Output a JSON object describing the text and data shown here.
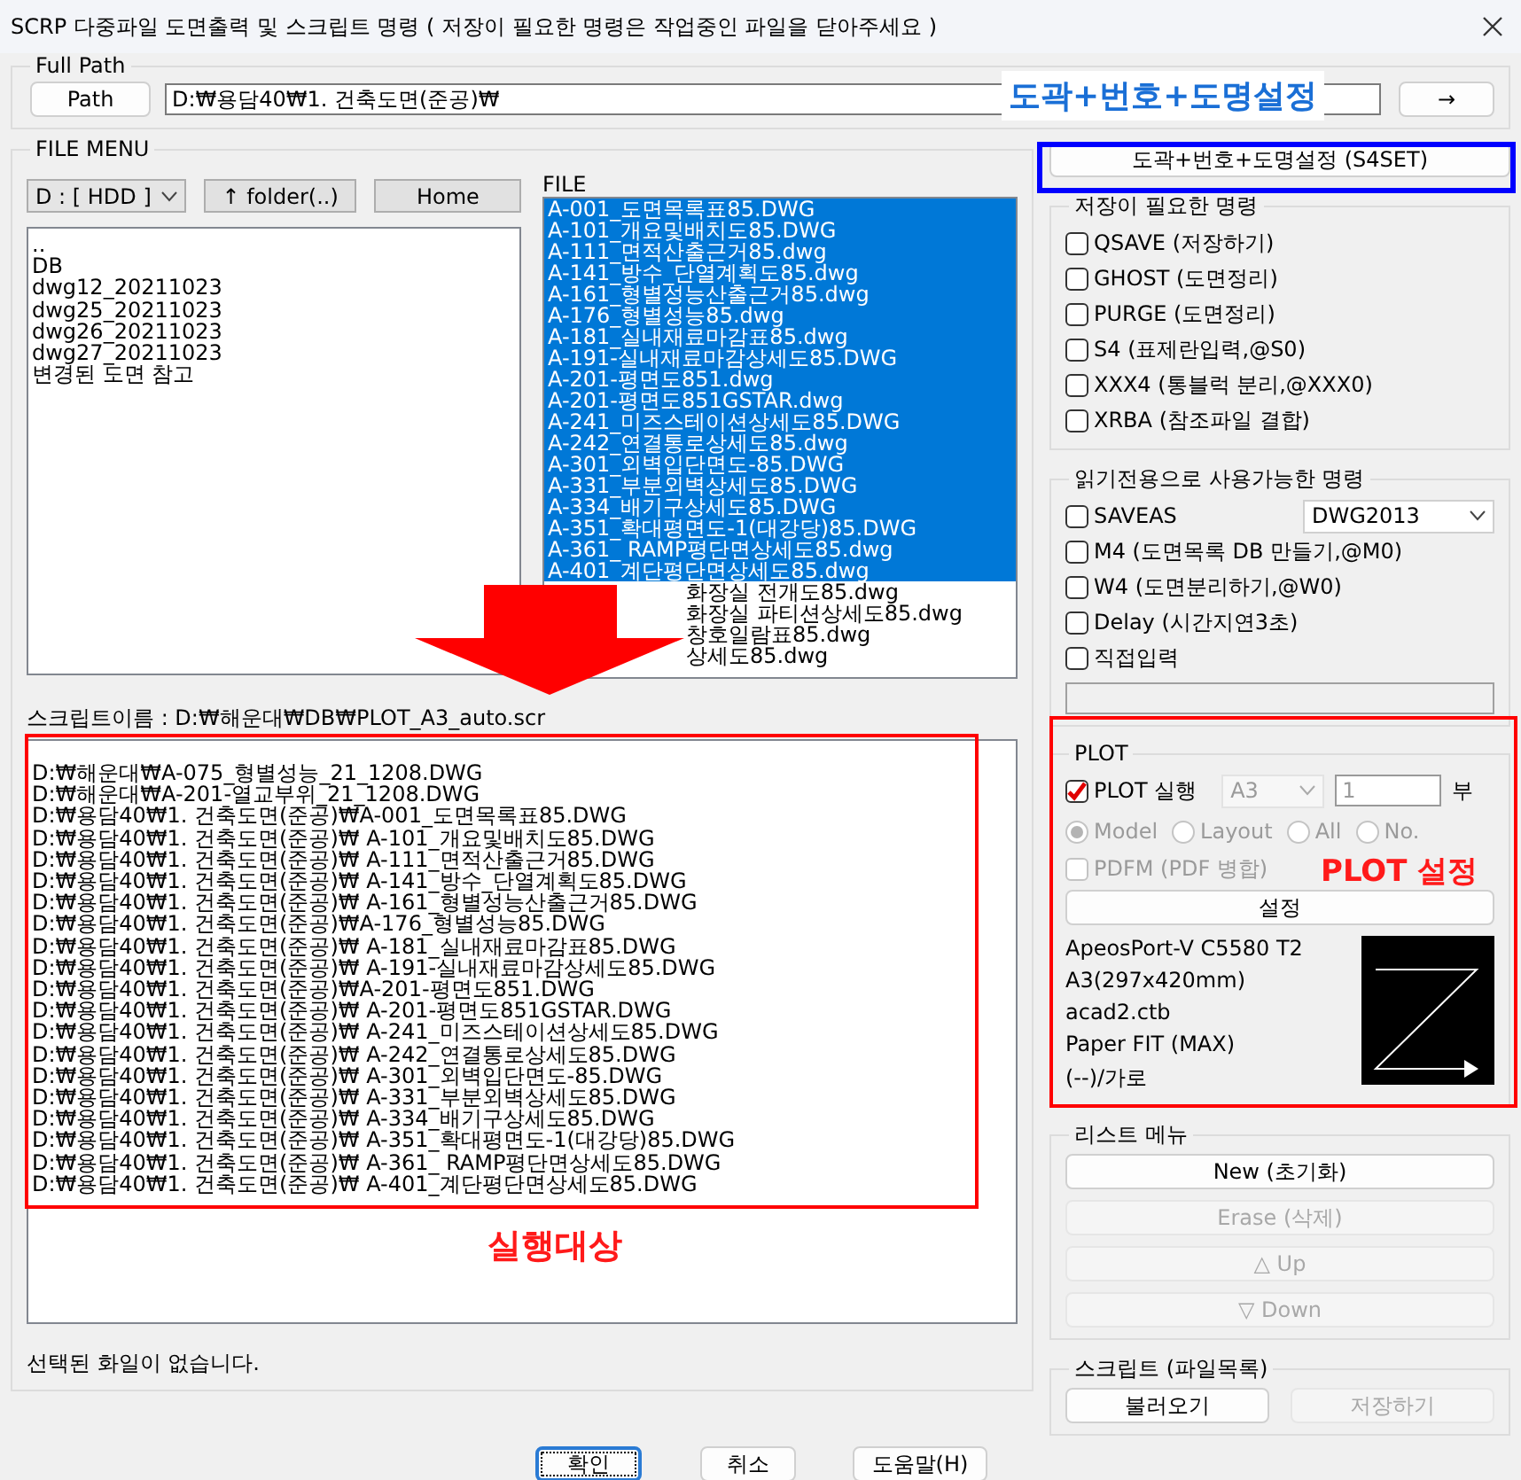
{
  "window": {
    "title": "SCRP 다중파일 도면출력 및 스크립트 명령 ( 저장이 필요한 명령은 작업중인 파일을 닫아주세요 )"
  },
  "full_path": {
    "label": "Full Path",
    "path_button": "Path",
    "path_value": "D:₩용담40₩1. 건축도면(준공)₩",
    "go_button": "→"
  },
  "file_menu": {
    "label": "FILE MENU",
    "drive": "D : [ HDD ]",
    "folder_button": "↑ folder(..)",
    "home_button": "Home",
    "folders": [
      "..",
      "DB",
      "dwg12_20211023",
      "dwg25_20211023",
      "dwg26_20211023",
      "dwg27_20211023",
      "변경된 도면 참고"
    ],
    "file_label": "FILE",
    "files": [
      {
        "name": "A-001_도면목록표85.DWG",
        "selected": true
      },
      {
        "name": "A-101_개요및배치도85.DWG",
        "selected": true
      },
      {
        "name": "A-111_면적산출근거85.dwg",
        "selected": true
      },
      {
        "name": "A-141_방수_단열계획도85.dwg",
        "selected": true
      },
      {
        "name": "A-161_형별성능산출근거85.dwg",
        "selected": true
      },
      {
        "name": "A-176_형별성능85.dwg",
        "selected": true
      },
      {
        "name": "A-181_실내재료마감표85.dwg",
        "selected": true
      },
      {
        "name": "A-191-실내재료마감상세도85.DWG",
        "selected": true
      },
      {
        "name": "A-201-평면도851.dwg",
        "selected": true
      },
      {
        "name": "A-201-평면도851GSTAR.dwg",
        "selected": true
      },
      {
        "name": "A-241_미즈스테이션상세도85.DWG",
        "selected": true
      },
      {
        "name": "A-242_연결통로상세도85.dwg",
        "selected": true
      },
      {
        "name": "A-301_외벽입단면도-85.DWG",
        "selected": true
      },
      {
        "name": "A-331_부분외벽상세도85.DWG",
        "selected": true
      },
      {
        "name": "A-334_배기구상세도85.DWG",
        "selected": true
      },
      {
        "name": "A-351_확대평면도-1(대강당)85.DWG",
        "selected": true
      },
      {
        "name": "A-361_ RAMP평단면상세도85.dwg",
        "selected": true
      },
      {
        "name": "A-401_계단평단면상세도85.dwg",
        "selected": true
      },
      {
        "name": "화장실 전개도85.dwg",
        "selected": false
      },
      {
        "name": "화장실 파티션상세도85.dwg",
        "selected": false
      },
      {
        "name": "창호일람표85.dwg",
        "selected": false
      },
      {
        "name": "상세도85.dwg",
        "selected": false
      }
    ],
    "script_name": "스크립트이름 : D:₩해운대₩DB₩PLOT_A3_auto.scr",
    "script_lines": [
      "D:₩해운대₩A-075_형별성능_21_1208.DWG",
      "D:₩해운대₩A-201-열교부위_21_1208.DWG",
      "D:₩용담40₩1. 건축도면(준공)₩A-001_도면목록표85.DWG",
      "D:₩용담40₩1. 건축도면(준공)₩ A-101_개요및배치도85.DWG",
      "D:₩용담40₩1. 건축도면(준공)₩ A-111_면적산출근거85.DWG",
      "D:₩용담40₩1. 건축도면(준공)₩ A-141_방수_단열계획도85.DWG",
      "D:₩용담40₩1. 건축도면(준공)₩ A-161_형별성능산출근거85.DWG",
      "D:₩용담40₩1. 건축도면(준공)₩A-176_형별성능85.DWG",
      "D:₩용담40₩1. 건축도면(준공)₩ A-181_실내재료마감표85.DWG",
      "D:₩용담40₩1. 건축도면(준공)₩ A-191-실내재료마감상세도85.DWG",
      "D:₩용담40₩1. 건축도면(준공)₩A-201-평면도851.DWG",
      "D:₩용담40₩1. 건축도면(준공)₩ A-201-평면도851GSTAR.DWG",
      "D:₩용담40₩1. 건축도면(준공)₩ A-241_미즈스테이션상세도85.DWG",
      "D:₩용담40₩1. 건축도면(준공)₩ A-242_연결통로상세도85.DWG",
      "D:₩용담40₩1. 건축도면(준공)₩ A-301_외벽입단면도-85.DWG",
      "D:₩용담40₩1. 건축도면(준공)₩ A-331_부분외벽상세도85.DWG",
      "D:₩용담40₩1. 건축도면(준공)₩ A-334_배기구상세도85.DWG",
      "D:₩용담40₩1. 건축도면(준공)₩ A-351_확대평면도-1(대강당)85.DWG",
      "D:₩용담40₩1. 건축도면(준공)₩ A-361_ RAMP평단면상세도85.DWG",
      "D:₩용담40₩1. 건축도면(준공)₩ A-401_계단평단면상세도85.DWG"
    ],
    "status": "선택된 화일이 없습니다."
  },
  "commands": {
    "s4set_button": "도곽+번호+도명설정 (S4SET)",
    "save_group": {
      "label": "저장이 필요한 명령",
      "options": [
        {
          "label": "QSAVE (저장하기)",
          "checked": false
        },
        {
          "label": "GHOST (도면정리)",
          "checked": false
        },
        {
          "label": "PURGE (도면정리)",
          "checked": false
        },
        {
          "label": "S4  (표제란입력,@S0)",
          "checked": false
        },
        {
          "label": "XXX4 (통블럭 분리,@XXX0)",
          "checked": false
        },
        {
          "label": "XRBA (참조파일 결합)",
          "checked": false
        }
      ]
    },
    "readonly_group": {
      "label": "읽기전용으로 사용가능한 명령",
      "saveas_format": "DWG2013",
      "options": [
        {
          "label": "SAVEAS",
          "checked": false
        },
        {
          "label": "M4  (도면목록 DB 만들기,@M0)",
          "checked": false
        },
        {
          "label": "W4  (도면분리하기,@W0)",
          "checked": false
        },
        {
          "label": "Delay (시간지연3초)",
          "checked": false
        },
        {
          "label": "직접입력",
          "checked": false
        }
      ]
    }
  },
  "plot": {
    "label": "PLOT",
    "run": {
      "label": "PLOT 실행",
      "checked": true
    },
    "paper": "A3",
    "copies": "1",
    "copies_unit": "부",
    "options_disabled": true,
    "modes": [
      {
        "label": "Model",
        "selected": true
      },
      {
        "label": "Layout",
        "selected": false
      },
      {
        "label": "All",
        "selected": false
      },
      {
        "label": "No.",
        "selected": false
      }
    ],
    "pdfm": {
      "label": "PDFM (PDF 병합)",
      "checked": false
    },
    "settings_button": "설정",
    "info": [
      "ApeosPort-V C5580 T2",
      "A3(297x420mm)",
      "acad2.ctb",
      "Paper FIT (MAX)",
      "(--)/가로"
    ]
  },
  "list_menu": {
    "label": "리스트 메뉴",
    "buttons": [
      {
        "label": "New (초기화)",
        "disabled": false
      },
      {
        "label": "Erase (삭제)",
        "disabled": true
      },
      {
        "label": "△ Up",
        "disabled": true
      },
      {
        "label": "▽ Down",
        "disabled": true
      }
    ]
  },
  "script_menu": {
    "label": "스크립트 (파일목록)",
    "buttons": [
      {
        "label": "불러오기",
        "disabled": false
      },
      {
        "label": "저장하기",
        "disabled": true
      }
    ]
  },
  "dialog_buttons": [
    {
      "label": "확인",
      "focused": true
    },
    {
      "label": "취소",
      "focused": false
    },
    {
      "label": "도움말(H)",
      "focused": false
    }
  ],
  "annotations": {
    "callout": "도곽+번호+도명설정",
    "plot_note": "PLOT 설정",
    "target_note": "실행대상"
  }
}
